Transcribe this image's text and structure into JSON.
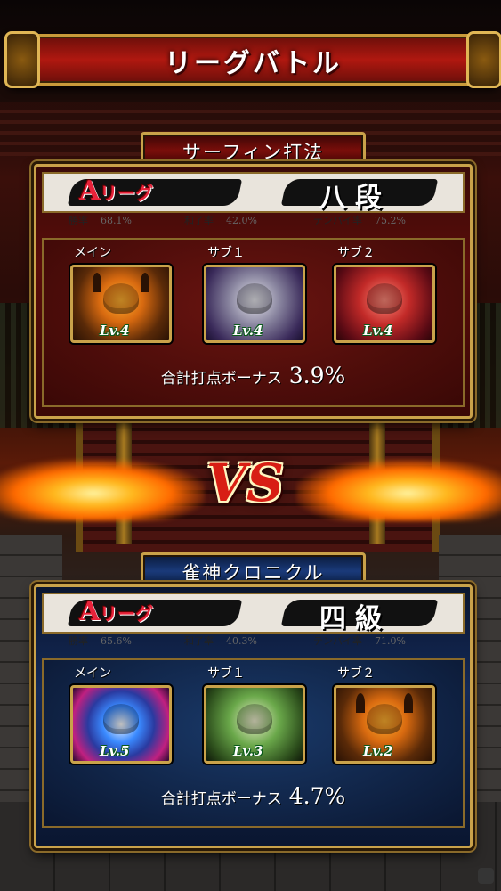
{
  "screen_title": "リーグバトル",
  "vs_label": "VS",
  "team_top": {
    "name": "サーフィン打法",
    "league_letter": "A",
    "league_text": "リーグ",
    "rank": "八段",
    "stats": {
      "win_label": "勝率",
      "win_value": "68.1%",
      "agari_label": "和了率",
      "agari_value": "42.0%",
      "tenpai_label": "テンパイ率",
      "tenpai_value": "75.2%"
    },
    "characters": [
      {
        "slot": "メイン",
        "level": "Lv.4",
        "portrait": "horned-oni-icon"
      },
      {
        "slot": "サブ１",
        "level": "Lv.4",
        "portrait": "grey-demon-icon"
      },
      {
        "slot": "サブ２",
        "level": "Lv.4",
        "portrait": "boar-demon-icon"
      }
    ],
    "bonus_label": "合計打点ボーナス",
    "bonus_value": "3.9%",
    "theme_color": "#7a0e0a"
  },
  "team_bottom": {
    "name": "雀神クロニクル",
    "league_letter": "A",
    "league_text": "リーグ",
    "rank": "四級",
    "stats": {
      "win_label": "勝率",
      "win_value": "65.6%",
      "agari_label": "和了率",
      "agari_value": "40.3%",
      "tenpai_label": "テンパイ率",
      "tenpai_value": "71.0%"
    },
    "characters": [
      {
        "slot": "メイン",
        "level": "Lv.5",
        "portrait": "blue-dragon-icon"
      },
      {
        "slot": "サブ１",
        "level": "Lv.3",
        "portrait": "green-haired-demon-icon"
      },
      {
        "slot": "サブ２",
        "level": "Lv.2",
        "portrait": "horned-oni-icon"
      }
    ],
    "bonus_label": "合計打点ボーナス",
    "bonus_value": "4.7%",
    "theme_color": "#1a3a7a"
  }
}
